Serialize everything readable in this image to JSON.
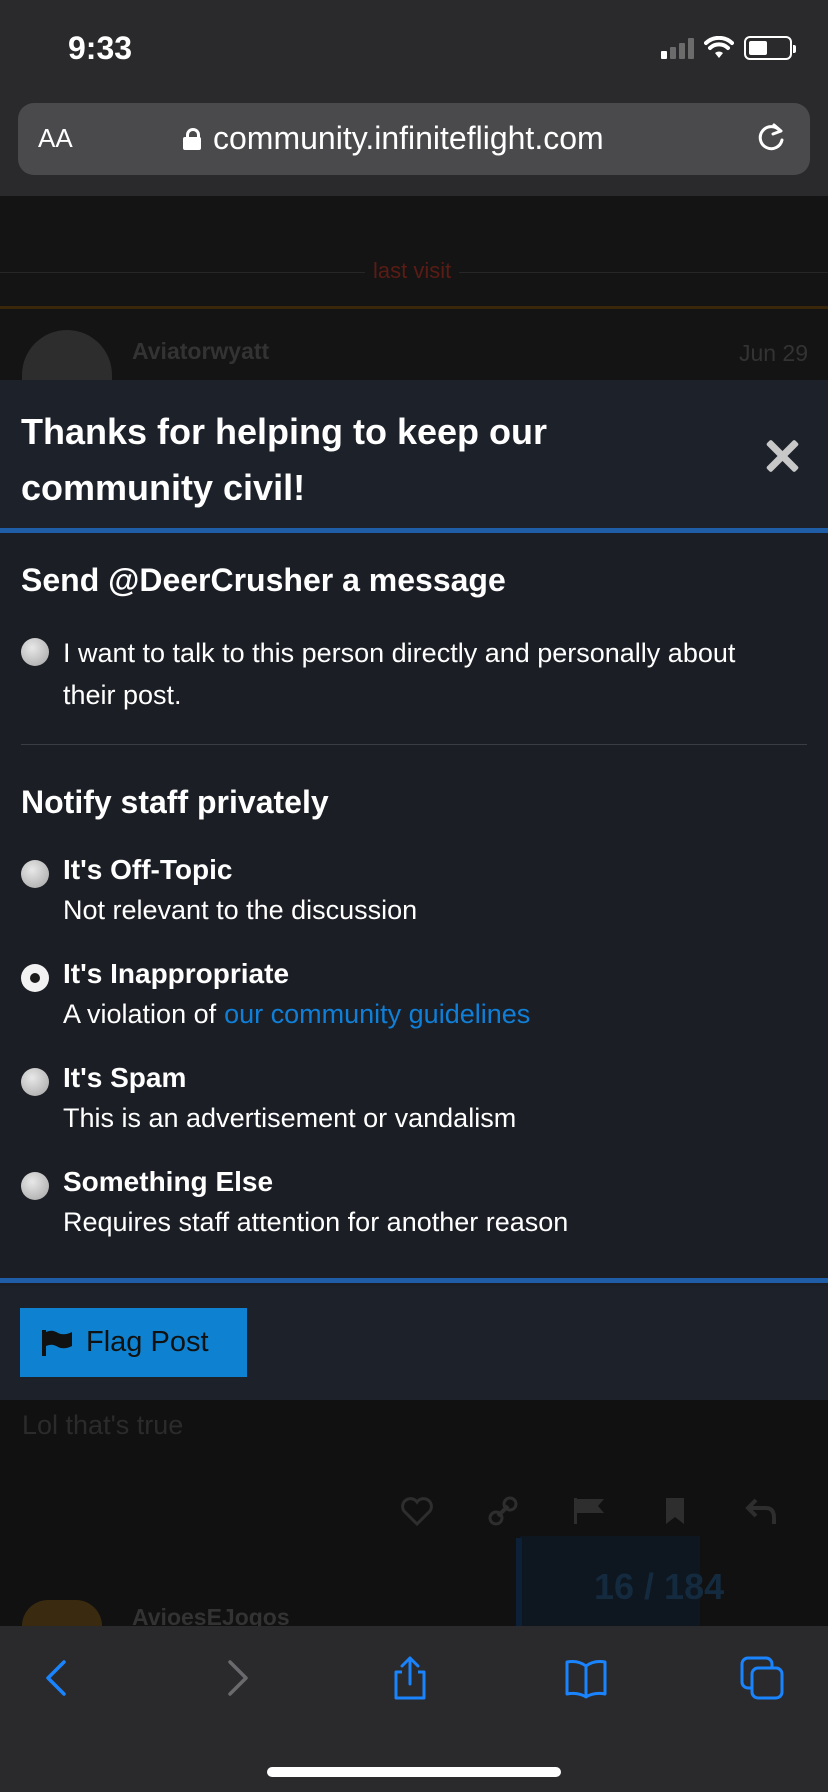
{
  "status_bar": {
    "time": "9:33"
  },
  "browser": {
    "text_size_label": "AA",
    "url": "community.infiniteflight.com"
  },
  "background": {
    "last_visit_label": "last visit",
    "top_post": {
      "username": "Aviatorwyatt",
      "date": "Jun 29"
    },
    "reply_text": "Lol that's true",
    "post_counter": "16 / 184",
    "next_post_username": "AvioesEJogos"
  },
  "modal": {
    "title": "Thanks for helping to keep our community civil!",
    "message_section": {
      "title": "Send @DeerCrusher a message",
      "option_text": "I want to talk to this person directly and personally about their post."
    },
    "staff_section": {
      "title": "Notify staff privately",
      "options": [
        {
          "title": "It's Off-Topic",
          "description": "Not relevant to the discussion",
          "checked": false
        },
        {
          "title": "It's Inappropriate",
          "description": "A violation of",
          "link": "our community guidelines",
          "checked": true
        },
        {
          "title": "It's Spam",
          "description": "This is an advertisement or vandalism",
          "checked": false
        },
        {
          "title": "Something Else",
          "description": "Requires staff attention for another reason",
          "checked": false
        }
      ]
    },
    "flag_button_label": "Flag Post",
    "accent_color": "#0e82d0",
    "link_color": "#0f7fd8"
  },
  "toolbar": {
    "icons": [
      "back-icon",
      "forward-icon",
      "share-icon",
      "bookmarks-icon",
      "tabs-icon"
    ]
  }
}
